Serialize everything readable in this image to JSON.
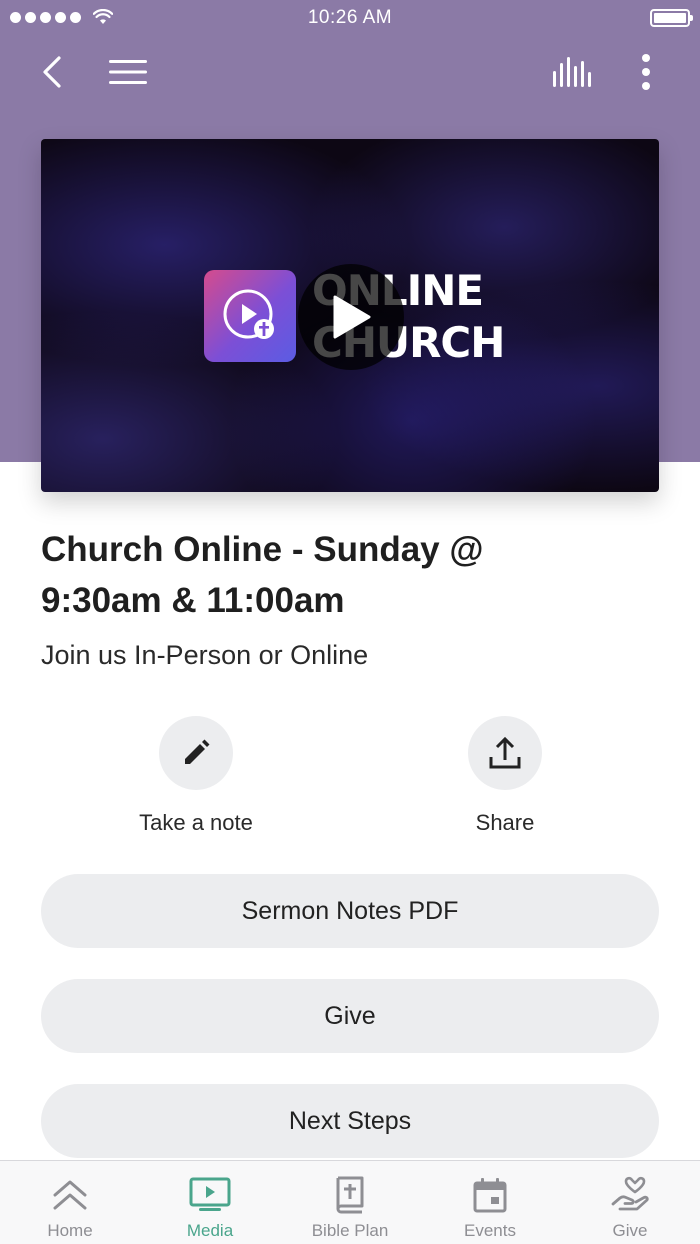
{
  "status_bar": {
    "time": "10:26 AM"
  },
  "colors": {
    "header": "#8b7aa6",
    "accent": "#4aa58c",
    "inactive": "#8e8e93",
    "button_bg": "#ecedef"
  },
  "nav": {
    "icons": [
      "back-chevron-icon",
      "menu-icon",
      "audio-bars-icon",
      "more-vertical-icon"
    ]
  },
  "video": {
    "overlay_title_line1": "ONLINE",
    "overlay_title_line2": "CHURCH"
  },
  "content": {
    "title": "Church Online - Sunday @ 9:30am & 11:00am",
    "subtitle": "Join us In-Person or Online"
  },
  "actions": [
    {
      "label": "Take a note",
      "icon": "pencil-icon"
    },
    {
      "label": "Share",
      "icon": "share-icon"
    }
  ],
  "buttons": [
    "Sermon Notes PDF",
    "Give",
    "Next Steps"
  ],
  "tabs": [
    {
      "label": "Home",
      "icon": "home-chevrons-icon",
      "active": false
    },
    {
      "label": "Media",
      "icon": "tv-play-icon",
      "active": true
    },
    {
      "label": "Bible Plan",
      "icon": "bible-icon",
      "active": false
    },
    {
      "label": "Events",
      "icon": "calendar-icon",
      "active": false
    },
    {
      "label": "Give",
      "icon": "heart-hand-icon",
      "active": false
    }
  ]
}
